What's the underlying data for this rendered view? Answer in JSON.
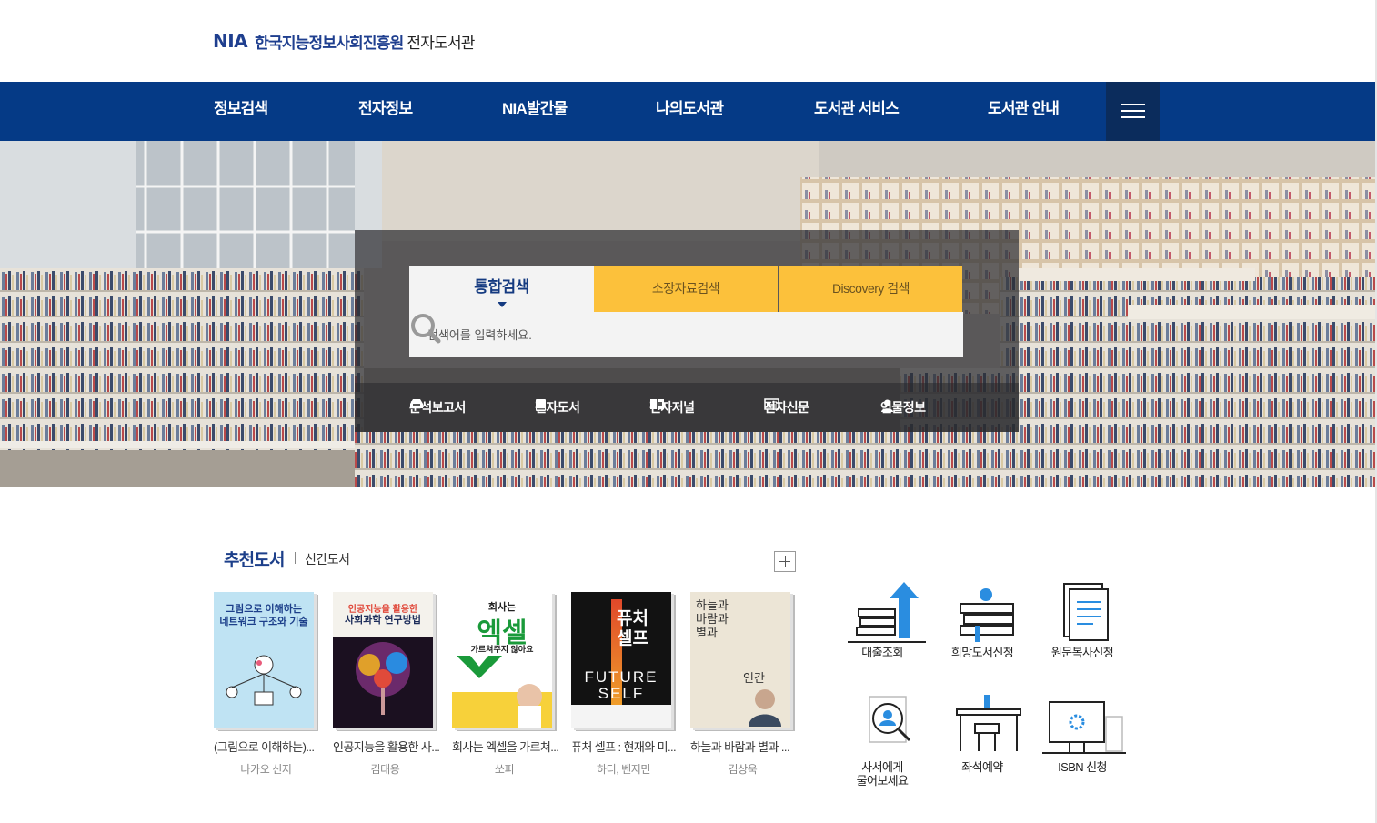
{
  "header": {
    "logo_abbr": "NIA",
    "logo_org": "한국지능정보사회진흥원",
    "logo_lib": "전자도서관"
  },
  "nav": {
    "items": [
      "정보검색",
      "전자정보",
      "NIA발간물",
      "나의도서관",
      "도서관 서비스",
      "도서관 안내"
    ],
    "menu_icon": "hamburger-icon"
  },
  "search": {
    "tabs": [
      "통합검색",
      "소장자료검색",
      "Discovery 검색"
    ],
    "active_tab": "통합검색",
    "placeholder": "검색어를 입력하세요.",
    "quick_links": [
      "분석보고서",
      "전자도서",
      "전자저널",
      "전자신문",
      "인물정보"
    ]
  },
  "books": {
    "title": "추천도서",
    "subtitle": "신간도서",
    "items": [
      {
        "title": "(그림으로 이해하는)...",
        "author": "나카오 신지",
        "cover_text": [
          "그림으로 이해하는",
          "네트워크 구조와 기술"
        ]
      },
      {
        "title": "인공지능을 활용한 사...",
        "author": "김태용",
        "cover_text": [
          "인공지능을 활용한",
          "사회과학 연구방법"
        ]
      },
      {
        "title": "회사는 엑셀을 가르쳐...",
        "author": "쏘피",
        "cover_text": [
          "회사는",
          "엑셀",
          "가르쳐주지 않아요"
        ]
      },
      {
        "title": "퓨처 셀프 : 현재와 미...",
        "author": "하디, 벤저민",
        "cover_text": [
          "퓨처",
          "셀프",
          "FUTURE",
          "SELF"
        ]
      },
      {
        "title": "하늘과 바람과 별과 ...",
        "author": "김상욱",
        "cover_text": [
          "하늘과",
          "바람과",
          "별과",
          "인간"
        ]
      }
    ]
  },
  "services": [
    {
      "label": "대출조회",
      "icon": "books-upload-icon"
    },
    {
      "label": "희망도서신청",
      "icon": "book-request-icon"
    },
    {
      "label": "원문복사신청",
      "icon": "document-copy-icon"
    },
    {
      "label": "사서에게 물어보세요",
      "icon": "ask-librarian-icon"
    },
    {
      "label": "좌석예약",
      "icon": "seat-reservation-icon"
    },
    {
      "label": "ISBN 신청",
      "icon": "isbn-monitor-icon"
    }
  ],
  "colors": {
    "nav_bg": "#053a86",
    "accent_yellow": "#fcc13b",
    "title_blue": "#1c3f8a"
  }
}
